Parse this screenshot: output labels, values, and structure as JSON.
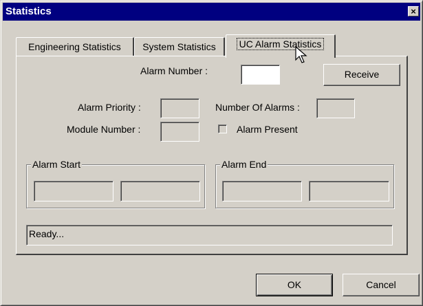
{
  "window": {
    "title": "Statistics",
    "close_glyph": "×"
  },
  "tabs": [
    {
      "label": "Engineering Statistics",
      "active": false
    },
    {
      "label": "System Statistics",
      "active": false
    },
    {
      "label": "UC Alarm Statistics",
      "active": true
    }
  ],
  "form": {
    "alarm_number_label": "Alarm Number :",
    "alarm_number_value": "",
    "receive_label": "Receive",
    "alarm_priority_label": "Alarm Priority :",
    "alarm_priority_value": "",
    "number_of_alarms_label": "Number Of Alarms :",
    "number_of_alarms_value": "",
    "module_number_label": "Module Number :",
    "module_number_value": "",
    "alarm_present_label": "Alarm Present",
    "alarm_present_checked": false
  },
  "alarm_start": {
    "title": "Alarm Start",
    "date": "",
    "time": ""
  },
  "alarm_end": {
    "title": "Alarm End",
    "date": "",
    "time": ""
  },
  "status": {
    "text": "Ready..."
  },
  "buttons": {
    "ok": "OK",
    "cancel": "Cancel"
  },
  "colors": {
    "titlebar": "#000080",
    "face": "#d4d0c8"
  }
}
